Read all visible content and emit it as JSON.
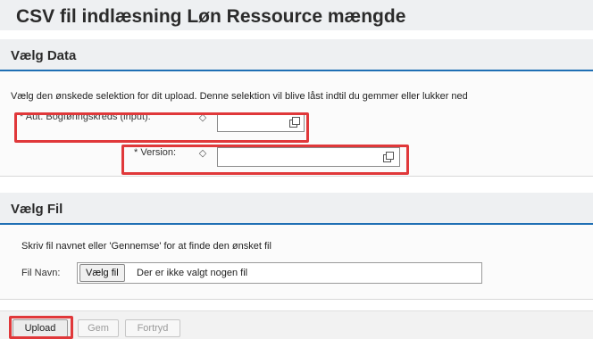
{
  "page": {
    "title": "CSV fil indlæsning Løn Ressource mængde"
  },
  "select_data": {
    "heading": "Vælg Data",
    "instruction": "Vælg den ønskede selektion for dit upload. Denne selektion vil blive låst indtil du gemmer eller lukker ned",
    "fields": [
      {
        "label": "* Aut. Bogføringskreds (input):",
        "value": ""
      },
      {
        "label": "* Version:",
        "value": ""
      }
    ]
  },
  "select_file": {
    "heading": "Vælg Fil",
    "instruction": "Skriv fil navnet eller 'Gennemse' for at finde den ønsket fil",
    "file_label": "Fil Navn:",
    "choose_button": "Vælg fil",
    "no_file_text": "Der er ikke valgt nogen fil"
  },
  "footer": {
    "upload": "Upload",
    "save": "Gem",
    "cancel": "Fortryd"
  },
  "colors": {
    "accent_line": "#1f6fb4",
    "highlight": "#e0383a",
    "header_bg": "#eef0f2"
  },
  "icons": [
    "diamond-icon",
    "value-help-icon"
  ]
}
